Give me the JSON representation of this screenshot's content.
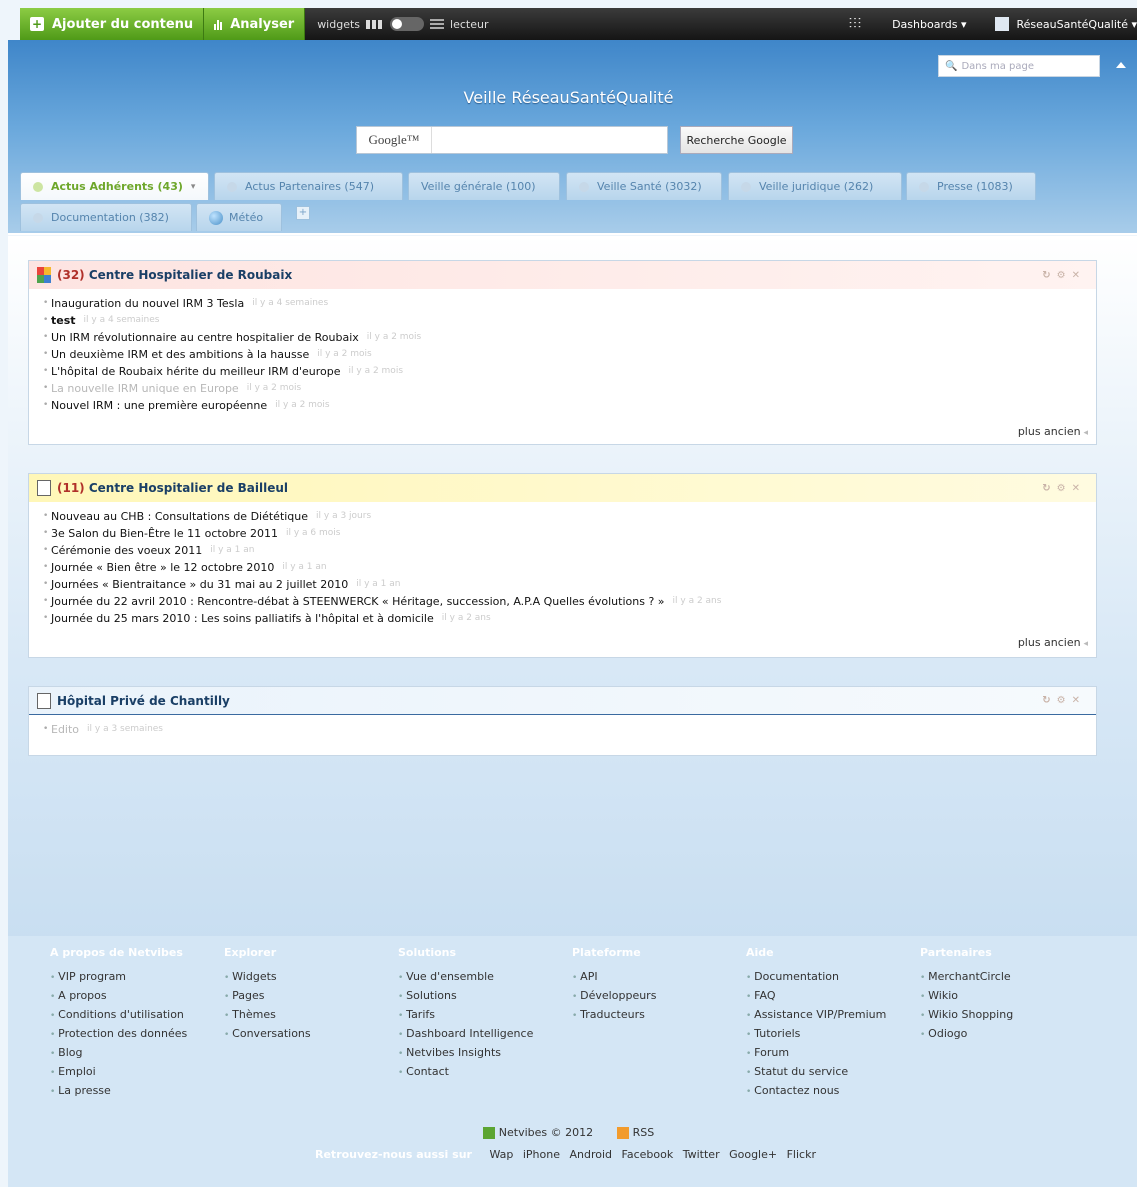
{
  "topbar": {
    "add_content": "Ajouter du contenu",
    "analyze": "Analyser",
    "widgets": "widgets",
    "reader": "lecteur",
    "dashboards": "Dashboards ▾",
    "account": "RéseauSantéQualité ▾"
  },
  "header": {
    "search_placeholder": "Dans ma page",
    "title": "Veille RéseauSantéQualité",
    "google_logo": "Google™",
    "google_button": "Recherche Google"
  },
  "tabs": [
    {
      "label": "Actus Adhérents (43)"
    },
    {
      "label": "Actus Partenaires (547)"
    },
    {
      "label": "Veille générale (100)"
    },
    {
      "label": "Veille Santé (3032)"
    },
    {
      "label": "Veille juridique (262)"
    },
    {
      "label": "Presse (1083)"
    },
    {
      "label": "Documentation (382)"
    },
    {
      "label": "Météo"
    }
  ],
  "widgets": [
    {
      "count": "(32)",
      "title": "Centre Hospitalier de Roubaix",
      "items": [
        {
          "text": "Inauguration du nouvel IRM 3 Tesla",
          "ago": "il y a 4 semaines"
        },
        {
          "text": "test",
          "ago": "il y a 4 semaines"
        },
        {
          "text": "Un IRM révolutionnaire au centre hospitalier de Roubaix",
          "ago": "il y a 2 mois"
        },
        {
          "text": "Un deuxième IRM et des ambitions à la hausse",
          "ago": "il y a 2 mois"
        },
        {
          "text": "L'hôpital de Roubaix hérite du meilleur IRM d'europe",
          "ago": "il y a 2 mois"
        },
        {
          "text": "La nouvelle IRM unique en Europe",
          "ago": "il y a 2 mois"
        },
        {
          "text": "Nouvel IRM : une première européenne",
          "ago": "il y a 2 mois"
        }
      ],
      "more": "plus ancien"
    },
    {
      "count": "(11)",
      "title": "Centre Hospitalier de Bailleul",
      "items": [
        {
          "text": "Nouveau au CHB : Consultations de Diététique",
          "ago": "il y a 3 jours"
        },
        {
          "text": "3e Salon du Bien-Être le 11 octobre 2011",
          "ago": "il y a 6 mois"
        },
        {
          "text": "Cérémonie des voeux 2011",
          "ago": "il y a 1 an"
        },
        {
          "text": "Journée « Bien être » le 12 octobre 2010",
          "ago": "il y a 1 an"
        },
        {
          "text": "Journées « Bientraitance » du 31 mai au 2 juillet 2010",
          "ago": "il y a 1 an"
        },
        {
          "text": "Journée du 22 avril 2010 : Rencontre-débat à STEENWERCK « Héritage, succession, A.P.A Quelles évolutions ? »",
          "ago": "il y a 2 ans"
        },
        {
          "text": "Journée du 25 mars 2010 : Les soins palliatifs à l'hôpital et à domicile",
          "ago": "il y a 2 ans"
        }
      ],
      "more": "plus ancien"
    },
    {
      "title": "Hôpital Privé de Chantilly",
      "items": [
        {
          "text": "Edito",
          "ago": "il y a 3 semaines"
        }
      ]
    }
  ],
  "footer": {
    "columns": [
      {
        "heading": "A propos de Netvibes",
        "items": [
          "VIP program",
          "A propos",
          "Conditions d'utilisation",
          "Protection des données",
          "Blog",
          "Emploi",
          "La presse"
        ]
      },
      {
        "heading": "Explorer",
        "items": [
          "Widgets",
          "Pages",
          "Thèmes",
          "Conversations"
        ]
      },
      {
        "heading": "Solutions",
        "items": [
          "Vue d'ensemble",
          "Solutions",
          "Tarifs",
          "Dashboard Intelligence",
          "Netvibes Insights",
          "Contact"
        ]
      },
      {
        "heading": "Plateforme",
        "items": [
          "API",
          "Développeurs",
          "Traducteurs"
        ]
      },
      {
        "heading": "Aide",
        "items": [
          "Documentation",
          "FAQ",
          "Assistance VIP/Premium",
          "Tutoriels",
          "Forum",
          "Statut du service",
          "Contactez nous"
        ]
      },
      {
        "heading": "Partenaires",
        "items": [
          "MerchantCircle",
          "Wikio",
          "Wikio Shopping",
          "Odiogo"
        ]
      }
    ],
    "copyright": "Netvibes © 2012",
    "rss": "RSS",
    "lead": "Retrouvez-nous aussi sur",
    "links": [
      "Wap",
      "iPhone",
      "Android",
      "Facebook",
      "Twitter",
      "Google+",
      "Flickr"
    ]
  }
}
